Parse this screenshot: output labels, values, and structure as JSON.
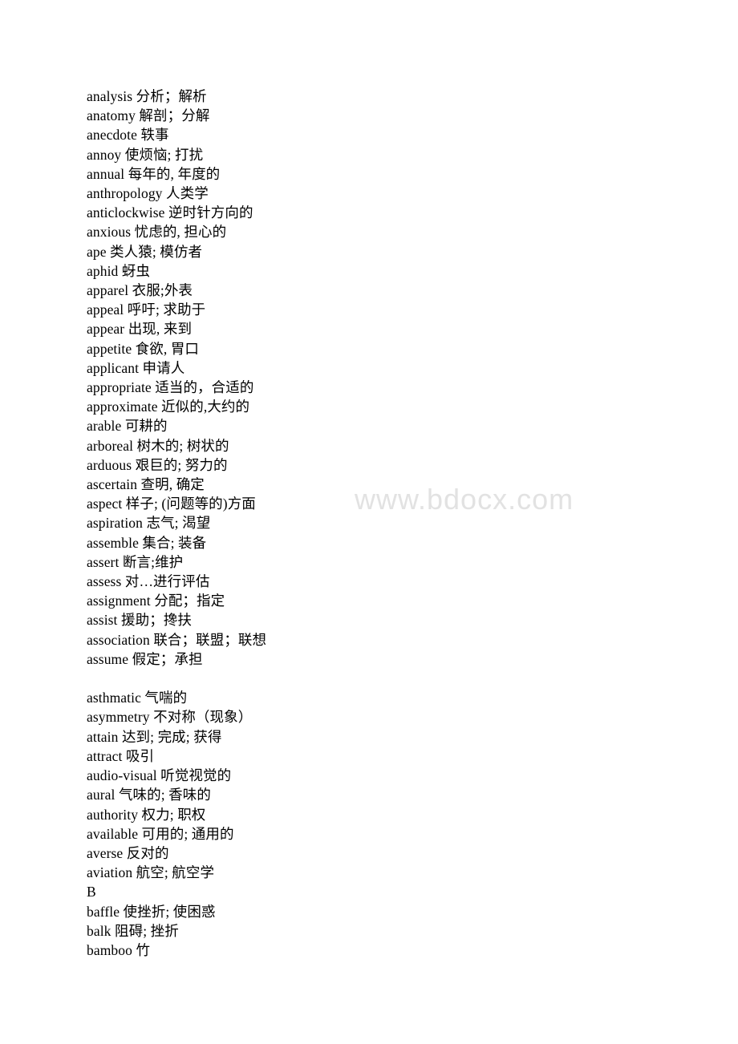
{
  "document": {
    "watermark": "www.bdocx.com",
    "entries": [
      "analysis 分析；解析",
      "anatomy 解剖；分解",
      "anecdote 轶事",
      "annoy 使烦恼; 打扰",
      "annual 每年的, 年度的",
      "anthropology 人类学",
      "anticlockwise 逆时针方向的",
      "anxious 忧虑的, 担心的",
      "ape 类人猿; 模仿者",
      "aphid 蚜虫",
      "apparel 衣服;外表",
      "appeal 呼吁; 求助于",
      "appear 出现, 来到",
      "appetite 食欲, 胃口",
      "applicant 申请人",
      "appropriate 适当的，合适的",
      "approximate 近似的,大约的",
      "arable 可耕的",
      "arboreal 树木的; 树状的",
      "arduous 艰巨的; 努力的",
      "ascertain 查明, 确定",
      "aspect 样子; (问题等的)方面",
      "aspiration 志气; 渴望",
      "assemble 集合; 装备",
      "assert 断言;维护",
      "assess 对…进行评估",
      "assignment 分配；指定",
      "assist 援助；搀扶",
      "association 联合；联盟；联想",
      "assume 假定；承担",
      "",
      "asthmatic 气喘的",
      "asymmetry 不对称（现象）",
      "attain 达到; 完成; 获得",
      "attract 吸引",
      "audio-visual 听觉视觉的",
      "aural 气味的; 香味的",
      "authority 权力; 职权",
      "available 可用的; 通用的",
      "averse 反对的",
      "aviation 航空; 航空学",
      "B",
      "baffle 使挫折; 使困惑",
      "balk 阻碍; 挫折",
      "bamboo 竹"
    ]
  }
}
